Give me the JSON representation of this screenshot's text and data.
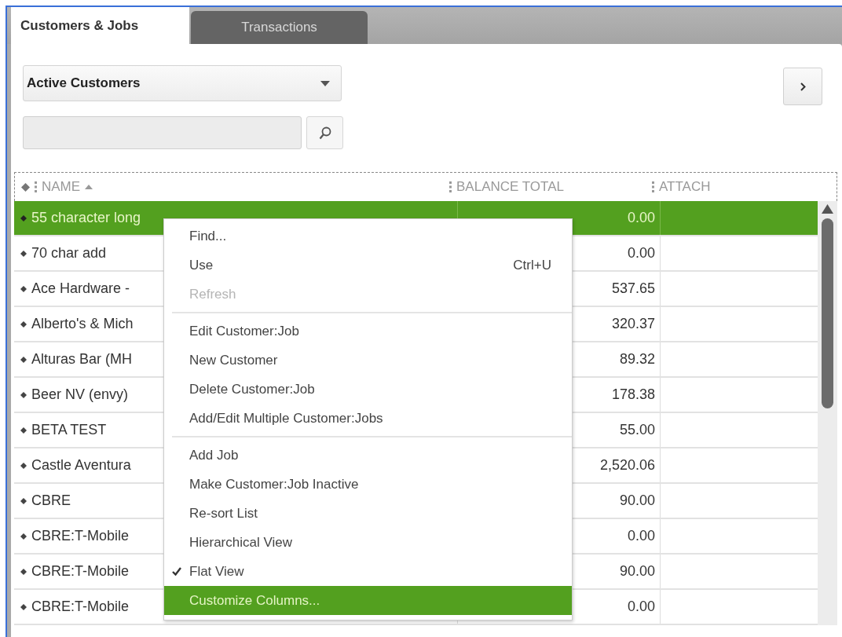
{
  "tabs": [
    {
      "label": "Customers & Jobs",
      "selected": true
    },
    {
      "label": "Transactions",
      "selected": false
    }
  ],
  "filter": {
    "value": "Active Customers"
  },
  "table": {
    "columns": [
      {
        "label": "NAME",
        "sorted": true
      },
      {
        "label": "BALANCE TOTAL",
        "sorted": false
      },
      {
        "label": "ATTACH",
        "sorted": false
      }
    ],
    "rows": [
      {
        "name": "55 character long",
        "balance": "0.00",
        "selected": true
      },
      {
        "name": "70 char add",
        "balance": "0.00",
        "selected": false
      },
      {
        "name": "Ace Hardware -",
        "balance": "537.65",
        "selected": false
      },
      {
        "name": "Alberto's & Mich",
        "balance": "320.37",
        "selected": false
      },
      {
        "name": "Alturas Bar (MH",
        "balance": "89.32",
        "selected": false
      },
      {
        "name": "Beer NV (envy)",
        "balance": "178.38",
        "selected": false
      },
      {
        "name": "BETA TEST",
        "balance": "55.00",
        "selected": false
      },
      {
        "name": "Castle Aventura",
        "balance": "2,520.06",
        "selected": false
      },
      {
        "name": "CBRE",
        "balance": "90.00",
        "selected": false
      },
      {
        "name": "CBRE:T-Mobile",
        "balance": "0.00",
        "selected": false
      },
      {
        "name": "CBRE:T-Mobile",
        "balance": "90.00",
        "selected": false
      },
      {
        "name": "CBRE:T-Mobile",
        "balance": "0.00",
        "selected": false
      }
    ]
  },
  "context_menu": {
    "groups": [
      [
        {
          "label": "Find...",
          "disabled": false,
          "checked": false,
          "selected": false
        },
        {
          "label": "Use",
          "shortcut": "Ctrl+U",
          "disabled": false,
          "checked": false,
          "selected": false
        },
        {
          "label": "Refresh",
          "disabled": true,
          "checked": false,
          "selected": false
        }
      ],
      [
        {
          "label": "Edit Customer:Job",
          "disabled": false,
          "checked": false,
          "selected": false
        },
        {
          "label": "New Customer",
          "disabled": false,
          "checked": false,
          "selected": false
        },
        {
          "label": "Delete Customer:Job",
          "disabled": false,
          "checked": false,
          "selected": false
        },
        {
          "label": "Add/Edit Multiple Customer:Jobs",
          "disabled": false,
          "checked": false,
          "selected": false
        }
      ],
      [
        {
          "label": "Add Job",
          "disabled": false,
          "checked": false,
          "selected": false
        },
        {
          "label": "Make Customer:Job Inactive",
          "disabled": false,
          "checked": false,
          "selected": false
        },
        {
          "label": "Re-sort List",
          "disabled": false,
          "checked": false,
          "selected": false
        },
        {
          "label": "Hierarchical View",
          "disabled": false,
          "checked": false,
          "selected": false
        },
        {
          "label": "Flat View",
          "disabled": false,
          "checked": true,
          "selected": false
        },
        {
          "label": "Customize Columns...",
          "disabled": false,
          "checked": false,
          "selected": true
        }
      ]
    ]
  }
}
